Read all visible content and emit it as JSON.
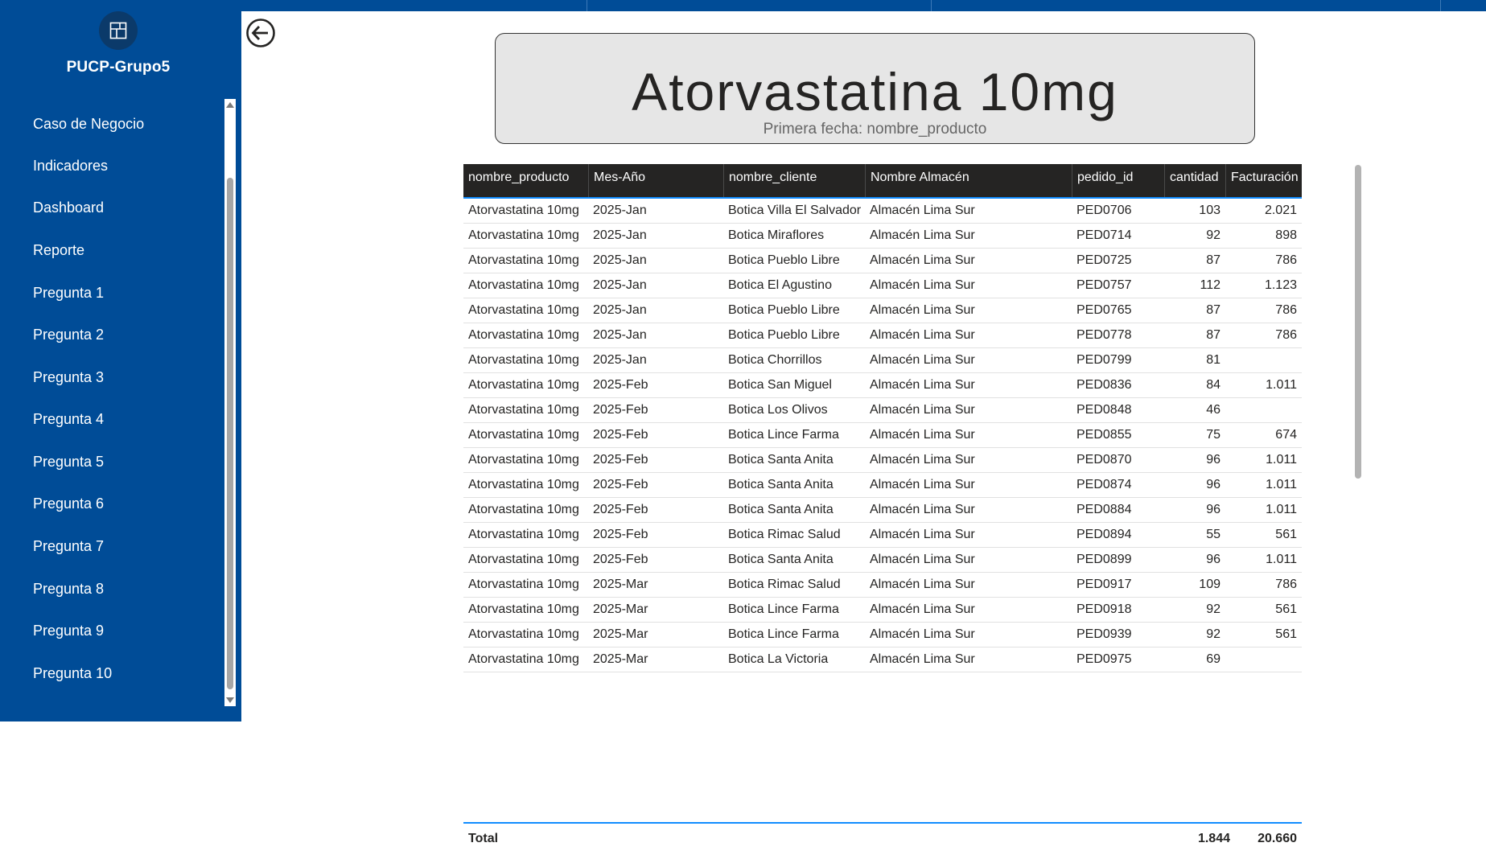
{
  "app": {
    "workspace_name": "PUCP-Grupo5",
    "workspace_icon": "report-workspace-icon"
  },
  "sidebar": {
    "items": [
      {
        "label": "Caso de Negocio"
      },
      {
        "label": "Indicadores"
      },
      {
        "label": "Dashboard"
      },
      {
        "label": "Reporte"
      },
      {
        "label": "Pregunta 1"
      },
      {
        "label": "Pregunta 2"
      },
      {
        "label": "Pregunta 3"
      },
      {
        "label": "Pregunta 4"
      },
      {
        "label": "Pregunta 5"
      },
      {
        "label": "Pregunta 6"
      },
      {
        "label": "Pregunta 7"
      },
      {
        "label": "Pregunta 8"
      },
      {
        "label": "Pregunta 9"
      },
      {
        "label": "Pregunta 10"
      }
    ]
  },
  "card": {
    "title": "Atorvastatina 10mg",
    "subtitle": "Primera fecha: nombre_producto"
  },
  "table": {
    "columns": [
      "nombre_producto",
      "Mes-Año",
      "nombre_cliente",
      "Nombre Almacén",
      "pedido_id",
      "cantidad",
      "Facturación"
    ],
    "rows": [
      [
        "Atorvastatina 10mg",
        "2025-Jan",
        "Botica Villa El Salvador",
        "Almacén Lima Sur",
        "PED0706",
        "103",
        "2.021"
      ],
      [
        "Atorvastatina 10mg",
        "2025-Jan",
        "Botica Miraflores",
        "Almacén Lima Sur",
        "PED0714",
        "92",
        "898"
      ],
      [
        "Atorvastatina 10mg",
        "2025-Jan",
        "Botica Pueblo Libre",
        "Almacén Lima Sur",
        "PED0725",
        "87",
        "786"
      ],
      [
        "Atorvastatina 10mg",
        "2025-Jan",
        "Botica El Agustino",
        "Almacén Lima Sur",
        "PED0757",
        "112",
        "1.123"
      ],
      [
        "Atorvastatina 10mg",
        "2025-Jan",
        "Botica Pueblo Libre",
        "Almacén Lima Sur",
        "PED0765",
        "87",
        "786"
      ],
      [
        "Atorvastatina 10mg",
        "2025-Jan",
        "Botica Pueblo Libre",
        "Almacén Lima Sur",
        "PED0778",
        "87",
        "786"
      ],
      [
        "Atorvastatina 10mg",
        "2025-Jan",
        "Botica Chorrillos",
        "Almacén Lima Sur",
        "PED0799",
        "81",
        ""
      ],
      [
        "Atorvastatina 10mg",
        "2025-Feb",
        "Botica San Miguel",
        "Almacén Lima Sur",
        "PED0836",
        "84",
        "1.011"
      ],
      [
        "Atorvastatina 10mg",
        "2025-Feb",
        "Botica Los Olivos",
        "Almacén Lima Sur",
        "PED0848",
        "46",
        ""
      ],
      [
        "Atorvastatina 10mg",
        "2025-Feb",
        "Botica Lince Farma",
        "Almacén Lima Sur",
        "PED0855",
        "75",
        "674"
      ],
      [
        "Atorvastatina 10mg",
        "2025-Feb",
        "Botica Santa Anita",
        "Almacén Lima Sur",
        "PED0870",
        "96",
        "1.011"
      ],
      [
        "Atorvastatina 10mg",
        "2025-Feb",
        "Botica Santa Anita",
        "Almacén Lima Sur",
        "PED0874",
        "96",
        "1.011"
      ],
      [
        "Atorvastatina 10mg",
        "2025-Feb",
        "Botica Santa Anita",
        "Almacén Lima Sur",
        "PED0884",
        "96",
        "1.011"
      ],
      [
        "Atorvastatina 10mg",
        "2025-Feb",
        "Botica Rimac Salud",
        "Almacén Lima Sur",
        "PED0894",
        "55",
        "561"
      ],
      [
        "Atorvastatina 10mg",
        "2025-Feb",
        "Botica Santa Anita",
        "Almacén Lima Sur",
        "PED0899",
        "96",
        "1.011"
      ],
      [
        "Atorvastatina 10mg",
        "2025-Mar",
        "Botica Rimac Salud",
        "Almacén Lima Sur",
        "PED0917",
        "109",
        "786"
      ],
      [
        "Atorvastatina 10mg",
        "2025-Mar",
        "Botica Lince Farma",
        "Almacén Lima Sur",
        "PED0918",
        "92",
        "561"
      ],
      [
        "Atorvastatina 10mg",
        "2025-Mar",
        "Botica Lince Farma",
        "Almacén Lima Sur",
        "PED0939",
        "92",
        "561"
      ],
      [
        "Atorvastatina 10mg",
        "2025-Mar",
        "Botica La Victoria",
        "Almacén Lima Sur",
        "PED0975",
        "69",
        ""
      ]
    ],
    "total": {
      "label": "Total",
      "cantidad": "1.844",
      "facturacion": "20.660"
    }
  },
  "colors": {
    "sidebar_bg": "#004c97",
    "header_bg": "#252423",
    "accent": "#118dff",
    "card_bg": "#e6e6e6"
  }
}
